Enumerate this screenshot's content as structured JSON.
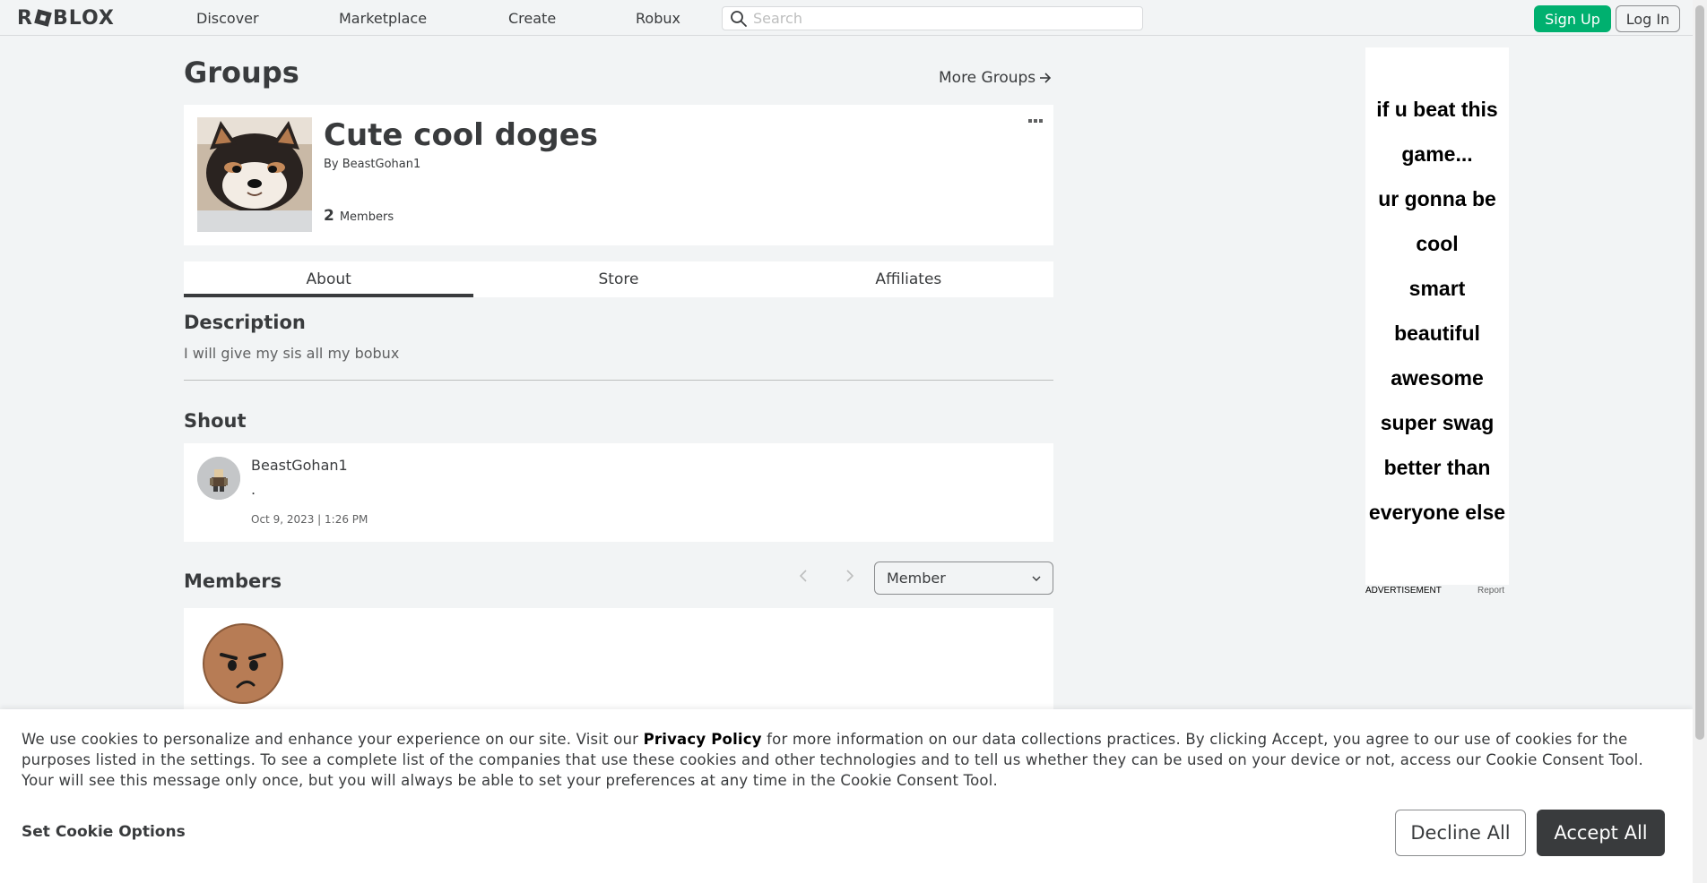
{
  "nav": {
    "logo": "ROBLOX",
    "items": [
      "Discover",
      "Marketplace",
      "Create",
      "Robux"
    ],
    "search_placeholder": "Search",
    "signup_label": "Sign Up",
    "login_label": "Log In"
  },
  "page": {
    "title": "Groups",
    "more_groups": "More Groups",
    "more_groups_icon": "arrow-right-icon"
  },
  "group": {
    "name": "Cute cool doges",
    "by_prefix": "By",
    "owner": "BeastGohan1",
    "member_count": "2",
    "members_label": "Members"
  },
  "tabs": [
    {
      "label": "About",
      "active": true
    },
    {
      "label": "Store",
      "active": false
    },
    {
      "label": "Affiliates",
      "active": false
    }
  ],
  "description": {
    "title": "Description",
    "text": "I will give my sis all my bobux"
  },
  "shout": {
    "title": "Shout",
    "user": "BeastGohan1",
    "body": ".",
    "timestamp": "Oct 9, 2023 | 1:26 PM"
  },
  "members": {
    "title": "Members",
    "role_selected": "Member"
  },
  "ad": {
    "lines": [
      "if u beat this",
      "game...",
      "ur gonna be",
      "cool",
      "smart",
      "beautiful",
      "awesome",
      "super swag",
      "better than",
      "everyone else"
    ],
    "label": "ADVERTISEMENT",
    "report": "Report"
  },
  "cookie": {
    "text_before": "We use cookies to personalize and enhance your experience on our site. Visit our ",
    "privacy_link": "Privacy Policy",
    "text_after": " for more information on our data collections practices. By clicking Accept, you agree to our use of cookies for the purposes listed in the settings. To see a complete list of the companies that use these cookies and other technologies and to tell us whether they can be used on your device or not, access our Cookie Consent Tool. Your will see this message only once, but you will always be able to set your preferences at any time in the Cookie Consent Tool.",
    "set_options": "Set Cookie Options",
    "decline": "Decline All",
    "accept": "Accept All"
  },
  "colors": {
    "accent_green": "#00b06f",
    "dark": "#393b3d",
    "background": "#f2f4f5"
  }
}
